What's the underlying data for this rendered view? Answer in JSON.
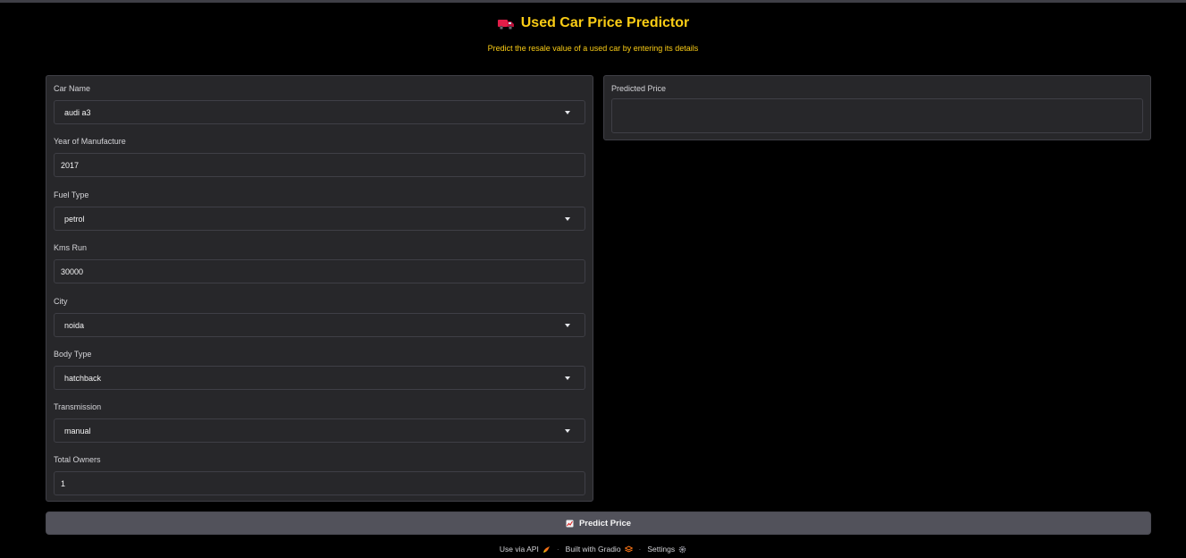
{
  "header": {
    "title": "Used Car Price Predictor",
    "title_icon": "delivery-truck-emoji",
    "subtitle": "Predict the resale value of a used car by entering its details"
  },
  "form": {
    "car_name": {
      "label": "Car Name",
      "value": "audi a3",
      "type": "dropdown"
    },
    "year": {
      "label": "Year of Manufacture",
      "value": "2017",
      "type": "number"
    },
    "fuel_type": {
      "label": "Fuel Type",
      "value": "petrol",
      "type": "dropdown"
    },
    "kms_run": {
      "label": "Kms Run",
      "value": "30000",
      "type": "number"
    },
    "city": {
      "label": "City",
      "value": "noida",
      "type": "dropdown"
    },
    "body_type": {
      "label": "Body Type",
      "value": "hatchback",
      "type": "dropdown"
    },
    "transmission": {
      "label": "Transmission",
      "value": "manual",
      "type": "dropdown"
    },
    "total_owners": {
      "label": "Total Owners",
      "value": "1",
      "type": "number"
    }
  },
  "output": {
    "label": "Predicted Price",
    "value": ""
  },
  "actions": {
    "predict_label": "Predict Price",
    "predict_icon": "chart-emoji"
  },
  "footer": {
    "api_label": "Use via API",
    "gradio_label": "Built with Gradio",
    "settings_label": "Settings",
    "separator": "·"
  },
  "colors": {
    "background": "#000000",
    "panel": "#27272a",
    "border": "#3f3f46",
    "accent": "#facc15",
    "button": "#52525b"
  }
}
